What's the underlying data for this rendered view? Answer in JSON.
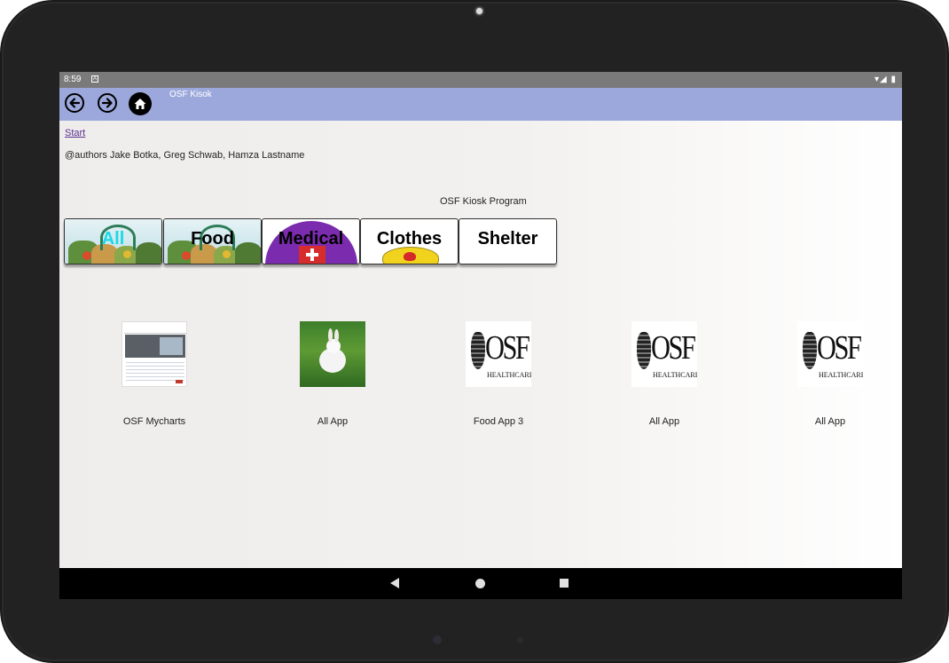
{
  "status_bar": {
    "time": "8:59",
    "notification_glyph": "A",
    "system_icons": "▾◢ ▮"
  },
  "app_bar": {
    "title": "OSF Kisok",
    "back_icon": "arrow-left-circle-icon",
    "forward_icon": "arrow-right-circle-icon",
    "home_icon": "home-circle-icon"
  },
  "content": {
    "start_link": "Start",
    "authors": "@authors Jake Botka, Greg Schwab, Hamza Lastname",
    "program_title": "OSF Kiosk Program"
  },
  "categories": [
    {
      "label": "All",
      "color": "#1ad9e6"
    },
    {
      "label": "Food",
      "color": "#000000"
    },
    {
      "label": "Medical",
      "color": "#000000"
    },
    {
      "label": "Clothes",
      "color": "#000000"
    },
    {
      "label": "Shelter",
      "color": "#000000"
    }
  ],
  "apps": [
    {
      "name": "OSF Mycharts",
      "thumb": "mychart-screenshot"
    },
    {
      "name": "All App",
      "thumb": "rabbit-photo"
    },
    {
      "name": "Food App 3",
      "thumb": "osf-healthcare-logo"
    },
    {
      "name": "All App",
      "thumb": "osf-healthcare-logo"
    },
    {
      "name": "All App",
      "thumb": "osf-healthcare-logo"
    }
  ],
  "osf_logo": {
    "word": "OSF",
    "sub": "HEALTHCARE"
  },
  "colors": {
    "app_bar": "#9ca8dc",
    "status_bar": "#7a7a7a",
    "link": "#5a2d91",
    "medical_purple": "#7b2cae"
  }
}
